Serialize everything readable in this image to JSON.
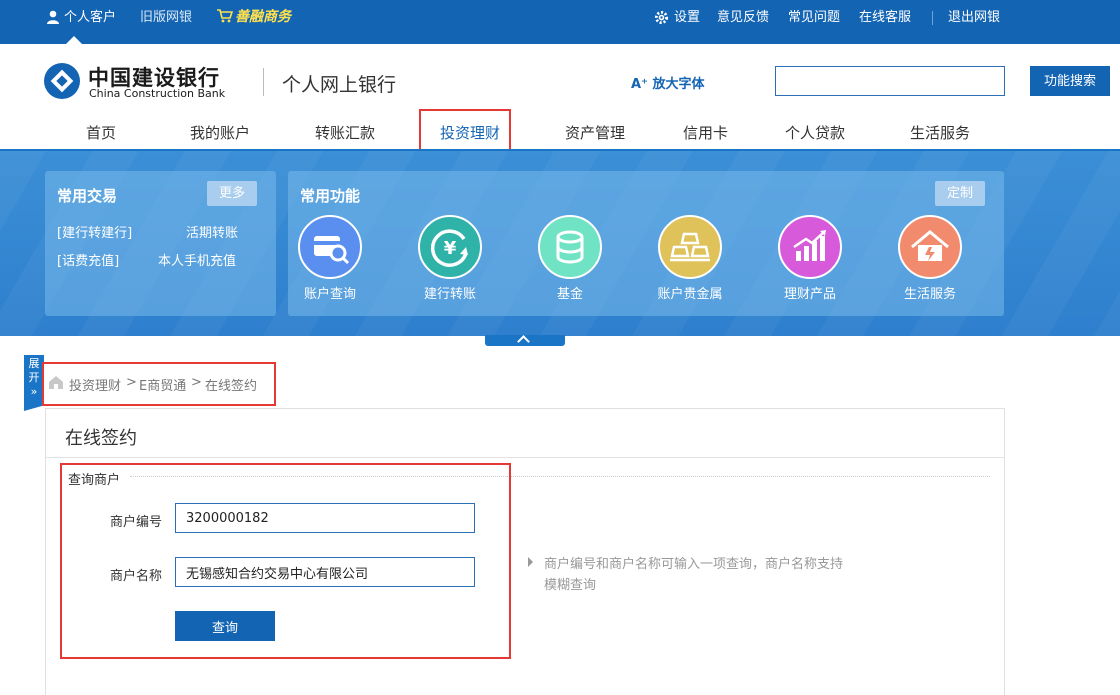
{
  "topbar": {
    "personal": "个人客户",
    "old_version": "旧版网银",
    "shop": "善融商务",
    "settings": "设置",
    "feedback": "意见反馈",
    "faq": "常见问题",
    "online_service": "在线客服",
    "logout": "退出网银"
  },
  "header": {
    "bank_name_cn": "中国建设银行",
    "bank_name_en": "China Construction Bank",
    "site_title": "个人网上银行",
    "enlarge_font": "放大字体",
    "search_value": "",
    "search_button": "功能搜索"
  },
  "nav": {
    "items": [
      "首页",
      "我的账户",
      "转账汇款",
      "投资理财",
      "资产管理",
      "信用卡",
      "个人贷款",
      "生活服务"
    ]
  },
  "common_trade": {
    "title": "常用交易",
    "more": "更多",
    "links": [
      "[建行转建行]",
      "活期转账",
      "[话费充值]",
      "本人手机充值"
    ]
  },
  "common_functions": {
    "title": "常用功能",
    "customize": "定制",
    "items": [
      {
        "label": "账户查询",
        "color": "#5a8ff0",
        "icon": "card-search-icon"
      },
      {
        "label": "建行转账",
        "color": "#2fb3a8",
        "icon": "yen-transfer-icon"
      },
      {
        "label": "基金",
        "color": "#6fe3c4",
        "icon": "coins-icon"
      },
      {
        "label": "账户贵金属",
        "color": "#e0c25a",
        "icon": "gold-bars-icon"
      },
      {
        "label": "理财产品",
        "color": "#d65ad9",
        "icon": "growth-chart-icon"
      },
      {
        "label": "生活服务",
        "color": "#f28a6e",
        "icon": "home-service-icon"
      }
    ]
  },
  "side_tab": {
    "label": "展开"
  },
  "breadcrumb": [
    "投资理财",
    "E商贸通",
    "在线签约"
  ],
  "panel": {
    "title": "在线签约",
    "section": "查询商户",
    "merchant_no_label": "商户编号",
    "merchant_no_value": "3200000182",
    "merchant_name_label": "商户名称",
    "merchant_name_value": "无锡感知合约交易中心有限公司",
    "query_button": "查询",
    "hint": "商户编号和商户名称可输入一项查询，商户名称支持模糊查询"
  }
}
